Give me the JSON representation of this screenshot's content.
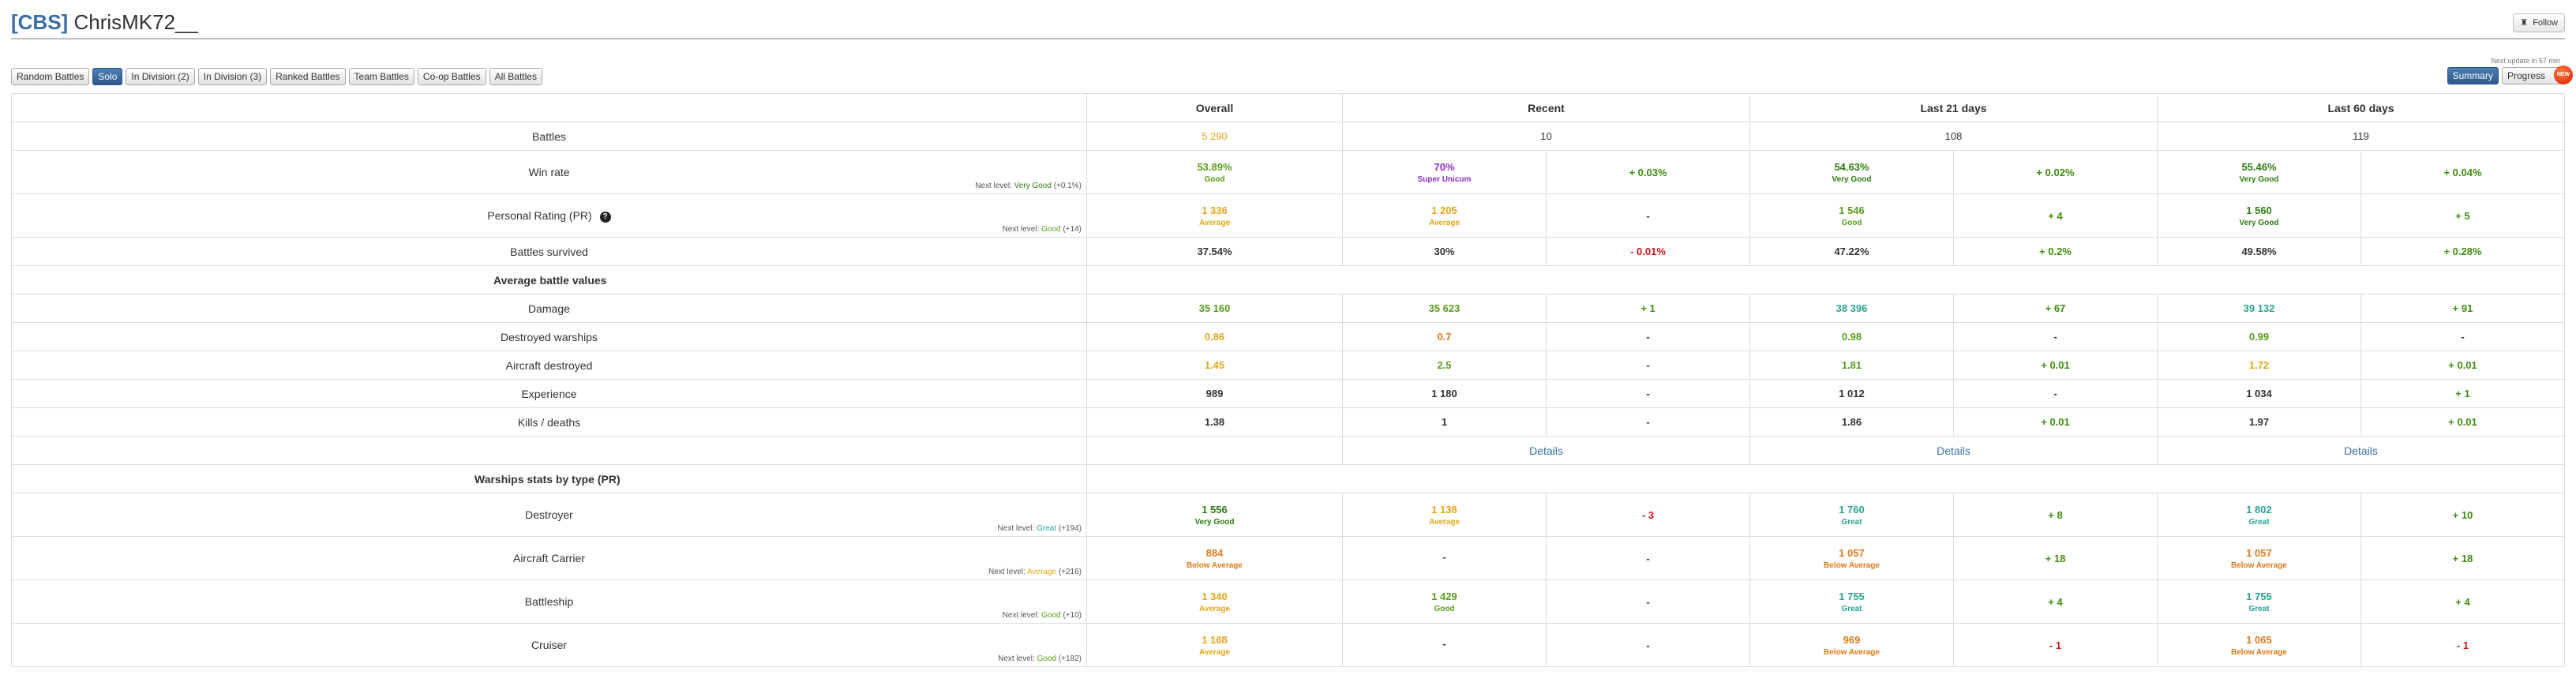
{
  "header": {
    "clan": "[CBS]",
    "player": "ChrisMK72__",
    "follow_label": "Follow",
    "next_update": "Next update in 57 min"
  },
  "mode_tabs": [
    "Random Battles",
    "Solo",
    "In Division (2)",
    "In Division (3)",
    "Ranked Battles",
    "Team Battles",
    "Co-op Battles",
    "All Battles"
  ],
  "active_mode": "Solo",
  "view_tabs": {
    "summary": "Summary",
    "progress": "Progress",
    "badge": "NEW"
  },
  "columns": [
    "Overall",
    "Recent",
    "Last 21 days",
    "Last 60 days"
  ],
  "colors": {
    "bad": "#d2151d",
    "below_average": "#e07a19",
    "average": "#e0a817",
    "good": "#5a9d1c",
    "very_good": "#2e7c12",
    "great": "#2aa394",
    "unicum": "#6a8fc7",
    "super_unicum": "#8a2fc7",
    "neutral": "#333333",
    "pos": "#3f8c0f"
  },
  "stats": {
    "battles": {
      "label": "Battles",
      "overall": "5 290",
      "recent": "10",
      "d21": "108",
      "d60": "119"
    },
    "winrate": {
      "label": "Win rate",
      "next": "Next level:",
      "next_q": "Very Good",
      "next_delta": "(+0.1%)",
      "overall": "53.89%",
      "overall_q": "Good",
      "recent": "70%",
      "recent_q": "Super Unicum",
      "recent_diff": "+ 0.03%",
      "d21": "54.63%",
      "d21_q": "Very Good",
      "d21_diff": "+ 0.02%",
      "d60": "55.46%",
      "d60_q": "Very Good",
      "d60_diff": "+ 0.04%"
    },
    "pr": {
      "label": "Personal Rating (PR)",
      "next": "Next level:",
      "next_q": "Good",
      "next_delta": "(+14)",
      "overall": "1 336",
      "overall_q": "Average",
      "recent": "1 205",
      "recent_q": "Average",
      "recent_diff": "-",
      "d21": "1 546",
      "d21_q": "Good",
      "d21_diff": "+ 4",
      "d60": "1 560",
      "d60_q": "Very Good",
      "d60_diff": "+ 5"
    },
    "survived": {
      "label": "Battles survived",
      "overall": "37.54%",
      "recent": "30%",
      "recent_diff": "- 0.01%",
      "d21": "47.22%",
      "d21_diff": "+ 0.2%",
      "d60": "49.58%",
      "d60_diff": "+ 0.28%"
    }
  },
  "avg_section": "Average battle values",
  "avg": [
    {
      "label": "Damage",
      "overall": "35 160",
      "recent": "35 623",
      "recent_diff": "+ 1",
      "d21": "38 396",
      "d21_diff": "+ 67",
      "d60": "39 132",
      "d60_diff": "+ 91"
    },
    {
      "label": "Destroyed warships",
      "overall": "0.86",
      "recent": "0.7",
      "recent_diff": "-",
      "d21": "0.98",
      "d21_diff": "-",
      "d60": "0.99",
      "d60_diff": "-"
    },
    {
      "label": "Aircraft destroyed",
      "overall": "1.45",
      "recent": "2.5",
      "recent_diff": "-",
      "d21": "1.81",
      "d21_diff": "+ 0.01",
      "d60": "1.72",
      "d60_diff": "+ 0.01"
    },
    {
      "label": "Experience",
      "overall": "989",
      "recent": "1 180",
      "recent_diff": "-",
      "d21": "1 012",
      "d21_diff": "-",
      "d60": "1 034",
      "d60_diff": "+ 1"
    },
    {
      "label": "Kills / deaths",
      "overall": "1.38",
      "recent": "1",
      "recent_diff": "-",
      "d21": "1.86",
      "d21_diff": "+ 0.01",
      "d60": "1.97",
      "d60_diff": "+ 0.01"
    }
  ],
  "details_label": "Details",
  "type_section": "Warships stats by type (PR)",
  "types": [
    {
      "label": "Destroyer",
      "next": "Next level:",
      "next_q": "Great",
      "next_delta": "(+194)",
      "overall": "1 556",
      "overall_q": "Very Good",
      "recent": "1 138",
      "recent_q": "Average",
      "recent_diff": "- 3",
      "d21": "1 760",
      "d21_q": "Great",
      "d21_diff": "+ 8",
      "d60": "1 802",
      "d60_q": "Great",
      "d60_diff": "+ 10"
    },
    {
      "label": "Aircraft Carrier",
      "next": "Next level:",
      "next_q": "Average",
      "next_delta": "(+216)",
      "overall": "884",
      "overall_q": "Below Average",
      "recent": "-",
      "recent_q": "",
      "recent_diff": "-",
      "d21": "1 057",
      "d21_q": "Below Average",
      "d21_diff": "+ 18",
      "d60": "1 057",
      "d60_q": "Below Average",
      "d60_diff": "+ 18"
    },
    {
      "label": "Battleship",
      "next": "Next level:",
      "next_q": "Good",
      "next_delta": "(+10)",
      "overall": "1 340",
      "overall_q": "Average",
      "recent": "1 429",
      "recent_q": "Good",
      "recent_diff": "-",
      "d21": "1 755",
      "d21_q": "Great",
      "d21_diff": "+ 4",
      "d60": "1 755",
      "d60_q": "Great",
      "d60_diff": "+ 4"
    },
    {
      "label": "Cruiser",
      "next": "Next level:",
      "next_q": "Good",
      "next_delta": "(+182)",
      "overall": "1 168",
      "overall_q": "Average",
      "recent": "-",
      "recent_q": "",
      "recent_diff": "-",
      "d21": "969",
      "d21_q": "Below Average",
      "d21_diff": "- 1",
      "d60": "1 065",
      "d60_q": "Below Average",
      "d60_diff": "- 1"
    }
  ]
}
